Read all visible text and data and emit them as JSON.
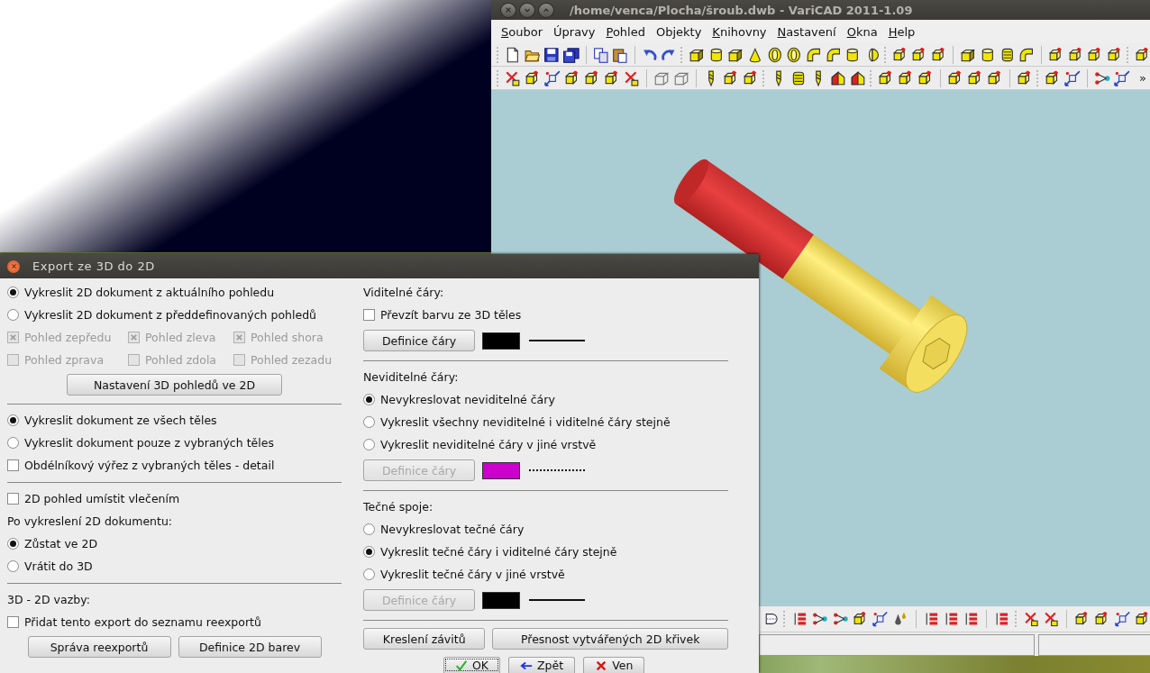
{
  "main_window": {
    "title": "/home/venca/Plocha/šroub.dwb - VariCAD 2011-1.09",
    "menu": [
      {
        "label": "Soubor",
        "mnemonic": true
      },
      {
        "label": "Úpravy",
        "mnemonic": false
      },
      {
        "label": "Pohled",
        "mnemonic": true
      },
      {
        "label": "Objekty",
        "mnemonic": false
      },
      {
        "label": "Knihovny",
        "mnemonic": true
      },
      {
        "label": "Nastavení",
        "mnemonic": true
      },
      {
        "label": "Okna",
        "mnemonic": true
      },
      {
        "label": "Help",
        "mnemonic": true
      }
    ],
    "toolbar_overflow": "»"
  },
  "dialog": {
    "title": "Export ze 3D do 2D",
    "left": [
      {
        "kind": "radio",
        "label": "Vykreslit 2D dokument z aktuálního pohledu",
        "selected": true
      },
      {
        "kind": "radio",
        "label": "Vykreslit 2D dokument z předdefinovaných pohledů",
        "selected": false
      },
      {
        "kind": "check_grid",
        "items": [
          {
            "label": "Pohled zepředu",
            "checked": true,
            "disabled": true
          },
          {
            "label": "Pohled zleva",
            "checked": true,
            "disabled": true
          },
          {
            "label": "Pohled shora",
            "checked": true,
            "disabled": true
          },
          {
            "label": "Pohled zprava",
            "checked": false,
            "disabled": true
          },
          {
            "label": "Pohled zdola",
            "checked": false,
            "disabled": true
          },
          {
            "label": "Pohled zezadu",
            "checked": false,
            "disabled": true
          }
        ]
      },
      {
        "kind": "button",
        "label": "Nastavení 3D pohledů ve 2D"
      },
      {
        "kind": "separator"
      },
      {
        "kind": "radio",
        "label": "Vykreslit dokument ze všech těles",
        "selected": true
      },
      {
        "kind": "radio",
        "label": "Vykreslit dokument pouze z vybraných těles",
        "selected": false
      },
      {
        "kind": "checkbox",
        "label": "Obdélníkový výřez z vybraných těles - detail",
        "checked": false
      },
      {
        "kind": "separator"
      },
      {
        "kind": "checkbox",
        "label": "2D pohled umístit vlečením",
        "checked": false
      },
      {
        "kind": "label",
        "label": "Po vykreslení 2D dokumentu:"
      },
      {
        "kind": "radio",
        "label": "Zůstat ve 2D",
        "selected": true
      },
      {
        "kind": "radio",
        "label": "Vrátit do 3D",
        "selected": false
      },
      {
        "kind": "separator"
      },
      {
        "kind": "label",
        "label": "3D - 2D vazby:"
      },
      {
        "kind": "checkbox",
        "label": "Přidat tento export do seznamu reexportů",
        "checked": false
      },
      {
        "kind": "buttons",
        "buttons": [
          {
            "label": "Správa reexportů"
          },
          {
            "label": "Definice 2D barev"
          }
        ]
      }
    ],
    "right": [
      {
        "kind": "label",
        "label": "Viditelné čáry:"
      },
      {
        "kind": "checkbox",
        "label": "Převzít barvu ze 3D těles",
        "checked": false
      },
      {
        "kind": "line_def",
        "button": "Definice čáry",
        "disabled": false,
        "color": "#000000"
      },
      {
        "kind": "separator"
      },
      {
        "kind": "label",
        "label": "Neviditelné čáry:"
      },
      {
        "kind": "radio",
        "label": "Nevykreslovat neviditelné čáry",
        "selected": true
      },
      {
        "kind": "radio",
        "label": "Vykreslit všechny neviditelné i viditelné čáry stejně",
        "selected": false
      },
      {
        "kind": "radio",
        "label": "Vykreslit neviditelné čáry v jiné vrstvě",
        "selected": false
      },
      {
        "kind": "line_def",
        "button": "Definice čáry",
        "disabled": true,
        "color": "#cc00cc"
      },
      {
        "kind": "separator"
      },
      {
        "kind": "label",
        "label": "Tečné spoje:"
      },
      {
        "kind": "radio",
        "label": "Nevykreslovat tečné čáry",
        "selected": false
      },
      {
        "kind": "radio",
        "label": "Vykreslit tečné čáry i viditelné čáry stejně",
        "selected": true
      },
      {
        "kind": "radio",
        "label": "Vykreslit tečné čáry v jiné vrstvě",
        "selected": false
      },
      {
        "kind": "line_def",
        "button": "Definice čáry",
        "disabled": true,
        "color": "#000000"
      },
      {
        "kind": "separator"
      },
      {
        "kind": "buttons",
        "buttons": [
          {
            "label": "Kreslení závitů"
          },
          {
            "label": "Přesnost vytvářených 2D křivek"
          }
        ]
      }
    ],
    "footer": [
      {
        "label": "OK",
        "focused": true
      },
      {
        "label": "Zpět",
        "focused": false
      },
      {
        "label": "Ven",
        "focused": false
      }
    ]
  }
}
